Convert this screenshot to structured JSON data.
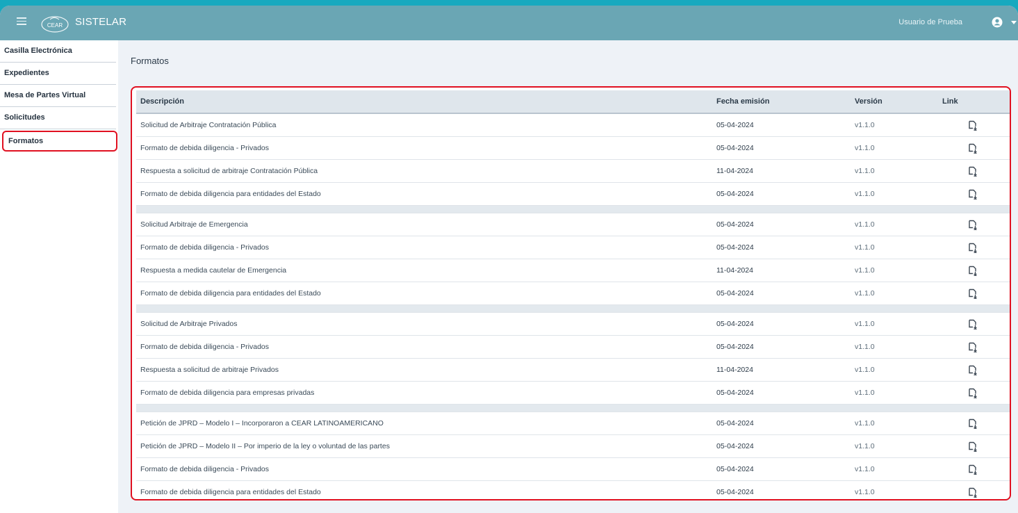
{
  "app": {
    "title": "SISTELAR",
    "logo_text": "CEAR"
  },
  "user": {
    "name": "Usuario de Prueba"
  },
  "sidebar": {
    "items": [
      {
        "label": "Casilla Electrónica"
      },
      {
        "label": "Expedientes"
      },
      {
        "label": "Mesa de Partes Virtual"
      },
      {
        "label": "Solicitudes"
      },
      {
        "label": "Formatos"
      }
    ],
    "active": "Formatos"
  },
  "page": {
    "title": "Formatos"
  },
  "table": {
    "headers": {
      "descripcion": "Descripción",
      "fecha": "Fecha emisión",
      "version": "Versión",
      "link": "Link"
    },
    "groups": [
      [
        {
          "desc": "Solicitud de Arbitraje Contratación Pública",
          "date": "05-04-2024",
          "version": "v1.1.0"
        },
        {
          "desc": "Formato de debida diligencia - Privados",
          "date": "05-04-2024",
          "version": "v1.1.0"
        },
        {
          "desc": "Respuesta a solicitud de arbitraje Contratación Pública",
          "date": "11-04-2024",
          "version": "v1.1.0"
        },
        {
          "desc": "Formato de debida diligencia para entidades del Estado",
          "date": "05-04-2024",
          "version": "v1.1.0"
        }
      ],
      [
        {
          "desc": "Solicitud Arbitraje de Emergencia",
          "date": "05-04-2024",
          "version": "v1.1.0"
        },
        {
          "desc": "Formato de debida diligencia - Privados",
          "date": "05-04-2024",
          "version": "v1.1.0"
        },
        {
          "desc": "Respuesta a medida cautelar de Emergencia",
          "date": "11-04-2024",
          "version": "v1.1.0"
        },
        {
          "desc": "Formato de debida diligencia para entidades del Estado",
          "date": "05-04-2024",
          "version": "v1.1.0"
        }
      ],
      [
        {
          "desc": "Solicitud de Arbitraje Privados",
          "date": "05-04-2024",
          "version": "v1.1.0"
        },
        {
          "desc": "Formato de debida diligencia - Privados",
          "date": "05-04-2024",
          "version": "v1.1.0"
        },
        {
          "desc": "Respuesta a solicitud de arbitraje Privados",
          "date": "11-04-2024",
          "version": "v1.1.0"
        },
        {
          "desc": "Formato de debida diligencia para empresas privadas",
          "date": "05-04-2024",
          "version": "v1.1.0"
        }
      ],
      [
        {
          "desc": "Petición de JPRD – Modelo I – Incorporaron a CEAR LATINOAMERICANO",
          "date": "05-04-2024",
          "version": "v1.1.0"
        },
        {
          "desc": "Petición de JPRD – Modelo II – Por imperio de la ley o voluntad de las partes",
          "date": "05-04-2024",
          "version": "v1.1.0"
        },
        {
          "desc": "Formato de debida diligencia - Privados",
          "date": "05-04-2024",
          "version": "v1.1.0"
        },
        {
          "desc": "Formato de debida diligencia para entidades del Estado",
          "date": "05-04-2024",
          "version": "v1.1.0"
        }
      ]
    ]
  },
  "colors": {
    "background": "#17a9bf",
    "topbar": "#6aa6b4",
    "highlight": "#e01020",
    "content": "#eef2f7"
  },
  "icons": {
    "menu": "hamburger-icon",
    "user": "user-circle-icon",
    "download": "file-download-icon"
  }
}
